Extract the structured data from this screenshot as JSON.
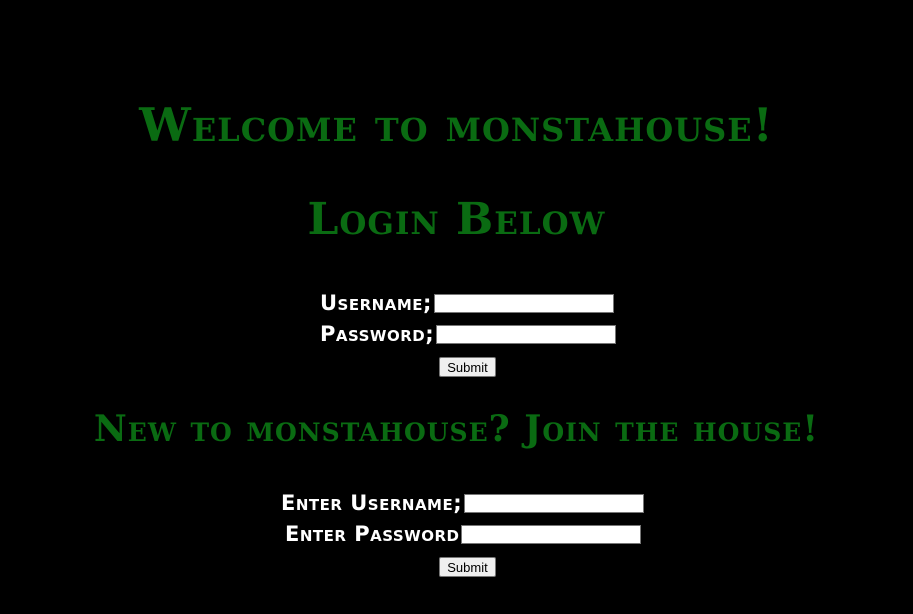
{
  "welcome_heading": "Welcome to monstahouse!",
  "login": {
    "title": "Login Below",
    "username_label": "Username;",
    "password_label": "Password;",
    "username_value": "",
    "password_value": "",
    "submit_label": "Submit"
  },
  "register": {
    "title": "New to monstahouse? Join the house!",
    "username_label": "Enter Username;",
    "password_label": "Enter Password",
    "username_value": "",
    "password_value": "",
    "submit_label": "Submit"
  },
  "colors": {
    "background": "#000000",
    "heading": "#0a6b12",
    "label": "#ffffff"
  }
}
